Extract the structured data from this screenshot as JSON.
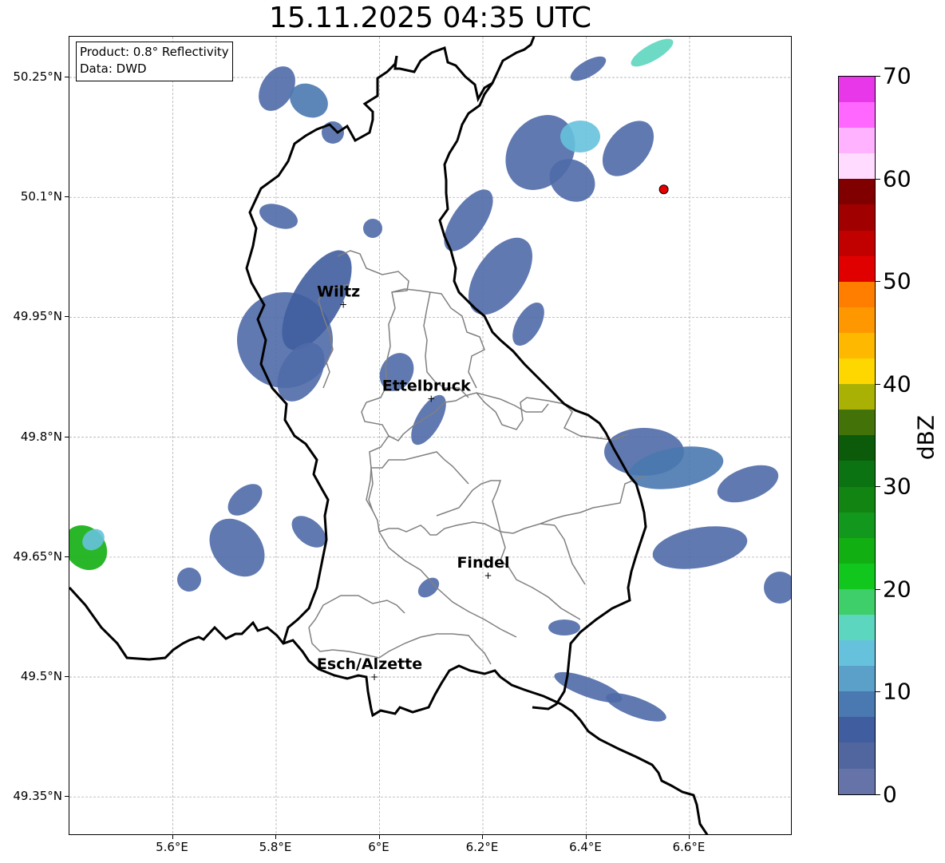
{
  "title": "15.11.2025 04:35 UTC",
  "info": {
    "product": "Product: 0.8° Reflectivity",
    "data": "Data: DWD"
  },
  "y_axis_labels": [
    "50.25°N",
    "50.1°N",
    "49.95°N",
    "49.8°N",
    "49.65°N",
    "49.5°N",
    "49.35°N"
  ],
  "x_axis_labels": [
    "5.6°E",
    "5.8°E",
    "6°E",
    "6.2°E",
    "6.4°E",
    "6.6°E"
  ],
  "cities": [
    {
      "name": "Wiltz",
      "lon": 5.93,
      "lat": 49.966
    },
    {
      "name": "Ettelbruck",
      "lon": 6.1,
      "lat": 49.848
    },
    {
      "name": "Findel",
      "lon": 6.21,
      "lat": 49.627
    },
    {
      "name": "Esch/Alzette",
      "lon": 5.99,
      "lat": 49.5
    }
  ],
  "marker": {
    "lon": 6.55,
    "lat": 50.11,
    "color": "#e60000"
  },
  "colorbar": {
    "title": "dBZ",
    "tick_labels": [
      "0",
      "10",
      "20",
      "30",
      "40",
      "50",
      "60",
      "70"
    ],
    "colors": [
      "#6573a8",
      "#51669e",
      "#405d9f",
      "#4a78b0",
      "#5aa0c8",
      "#66c2dc",
      "#5dd6c0",
      "#3ecf6a",
      "#11c61c",
      "#12af12",
      "#12981c",
      "#128412",
      "#0c7312",
      "#0b5b0b",
      "#437209",
      "#a9b105",
      "#ffd700",
      "#ffb800",
      "#ff9800",
      "#ff7e00",
      "#e10000",
      "#c10000",
      "#a10000",
      "#800000",
      "#ffdcff",
      "#ffb2ff",
      "#ff67ff",
      "#e837e8"
    ]
  },
  "grid": true
}
